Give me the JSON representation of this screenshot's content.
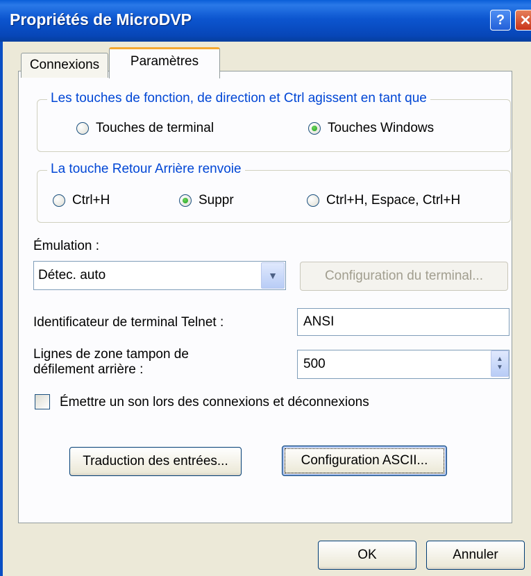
{
  "window": {
    "title": "Propriétés de MicroDVP",
    "help_label": "?",
    "close_label": "✕"
  },
  "tabs": [
    {
      "label": "Connexions",
      "selected": false
    },
    {
      "label": "Paramètres",
      "selected": true
    }
  ],
  "group_keys": {
    "legend": "Les touches de fonction, de direction et Ctrl agissent en tant que",
    "options": [
      {
        "label": "Touches de terminal",
        "selected": false
      },
      {
        "label": "Touches Windows",
        "selected": true
      }
    ]
  },
  "group_backspace": {
    "legend": "La touche Retour Arrière renvoie",
    "options": [
      {
        "label": "Ctrl+H",
        "selected": false
      },
      {
        "label": "Suppr",
        "selected": true
      },
      {
        "label": "Ctrl+H, Espace, Ctrl+H",
        "selected": false
      }
    ]
  },
  "emulation": {
    "label": "Émulation :",
    "value": "Détec. auto",
    "config_button": "Configuration du terminal..."
  },
  "telnet": {
    "label": "Identificateur de terminal Telnet :",
    "value": "ANSI"
  },
  "scrollback": {
    "label_line1": "Lignes de zone tampon de",
    "label_line2": "défilement arrière :",
    "value": "500"
  },
  "sound": {
    "label": "Émettre un son lors des connexions et déconnexions",
    "checked": false
  },
  "buttons": {
    "input_translation": "Traduction des entrées...",
    "ascii_setup": "Configuration ASCII...",
    "ok": "OK",
    "cancel": "Annuler"
  },
  "icons": {
    "dropdown": "chevron-down-icon",
    "spinner": "spinner-icon"
  }
}
